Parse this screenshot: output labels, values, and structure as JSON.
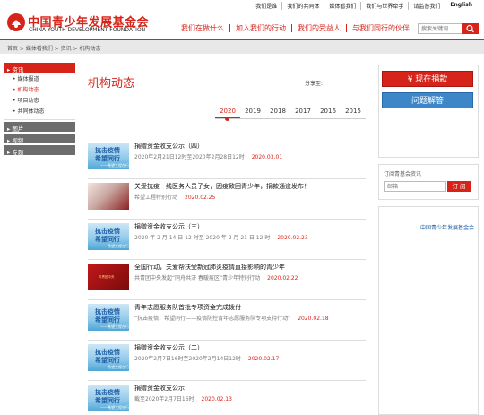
{
  "top_links": [
    "我们是谁",
    "我们的共同体",
    "媒体看我们",
    "我们与世界牵手",
    "请监督我们",
    "English"
  ],
  "logo": {
    "cn": "中国青少年发展基金会",
    "en": "CHINA YOUTH DEVELOPMENT FOUNDATION"
  },
  "main_nav": [
    "我们在做什么",
    "加入我们的行动",
    "我们的受益人",
    "与我们同行的伙伴"
  ],
  "search": {
    "placeholder": "搜索关键词"
  },
  "breadcrumb": "首页 > 媒体看我们 > 资讯 > 机构动态",
  "left_nav": {
    "sections": [
      {
        "label": "资讯",
        "active": true,
        "items": [
          "媒体报道",
          "机构动态",
          "项目动态",
          "共同体动态"
        ],
        "current": "机构动态"
      },
      {
        "label": "图片",
        "active": false
      },
      {
        "label": "视频",
        "active": false
      },
      {
        "label": "专题",
        "active": false
      }
    ]
  },
  "page_title": "机构动态",
  "share_label": "分享至:",
  "years": [
    "2020",
    "2019",
    "2018",
    "2017",
    "2016",
    "2015"
  ],
  "active_year": "2020",
  "news": [
    {
      "title": "捐赠资金收支公示（四）",
      "desc": "2020年2月21日12时至2020年2月28日12时",
      "date": "2020.03.01",
      "thumb": "blue",
      "thumb_text": [
        "抗击疫情",
        "希望同行",
        "——希望工程在行动"
      ]
    },
    {
      "title": "关爱抗疫一线医务人员子女，因疫致困青少年，捐款通道发布！",
      "desc": "希望工程特别行动",
      "date": "2020.02.25",
      "thumb": "photo"
    },
    {
      "title": "捐赠资金收支公示（三）",
      "desc": "2020 年 2 月 14 日 12 时至 2020 年 2 月 21 日 12 时",
      "date": "2020.02.23",
      "thumb": "blue",
      "thumb_text": [
        "抗击疫情",
        "希望同行",
        "——希望工程在行动"
      ]
    },
    {
      "title": "全国行动，关爱帮扶受新冠肺炎疫情直接影响的青少年",
      "desc": "共青团中央发起“同舟共济 春暖疫区”青少年特别行动",
      "date": "2020.02.22",
      "thumb": "red",
      "thumb_text": [
        "共青团中央"
      ]
    },
    {
      "title": "青年志愿服务队首批专项资金完成拨付",
      "desc": "“抗击疫情，希望同行——疫情防控青年志愿服务队专项支持行动”",
      "date": "2020.02.18",
      "thumb": "blue",
      "thumb_text": [
        "抗击疫情",
        "希望同行",
        "——希望工程在行动"
      ]
    },
    {
      "title": "捐赠资金收支公示（二）",
      "desc": "2020年2月7日16时至2020年2月14日12时",
      "date": "2020.02.17",
      "thumb": "blue",
      "thumb_text": [
        "抗击疫情",
        "希望同行",
        "——希望工程在行动"
      ]
    },
    {
      "title": "捐赠资金收支公示",
      "desc": "截至2020年2月7日16时",
      "date": "2020.02.13",
      "thumb": "blue",
      "thumb_text": [
        "抗击疫情",
        "希望同行",
        "——希望工程在行动"
      ]
    }
  ],
  "right": {
    "donate_label": "¥ 现在捐款",
    "qa_label": "问题解答",
    "subscribe_title": "订阅青基会资讯",
    "email_placeholder": "邮箱",
    "subscribe_btn": "订 阅",
    "qr_caption": "中国青少年发展基金会"
  },
  "colors": {
    "brand_red": "#d6241a",
    "brand_blue": "#3d86c7"
  }
}
